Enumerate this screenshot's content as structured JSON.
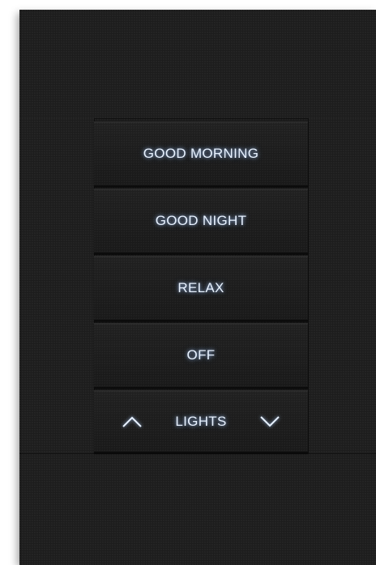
{
  "keypad": {
    "buttons": [
      {
        "label": "GOOD MORNING"
      },
      {
        "label": "GOOD NIGHT"
      },
      {
        "label": "RELAX"
      },
      {
        "label": "OFF"
      }
    ],
    "rocker": {
      "label": "LIGHTS",
      "up_icon": "chevron-up-icon",
      "down_icon": "chevron-down-icon"
    },
    "colors": {
      "plate": "#1b1b1b",
      "label_glow": "#e8f2ff"
    }
  }
}
